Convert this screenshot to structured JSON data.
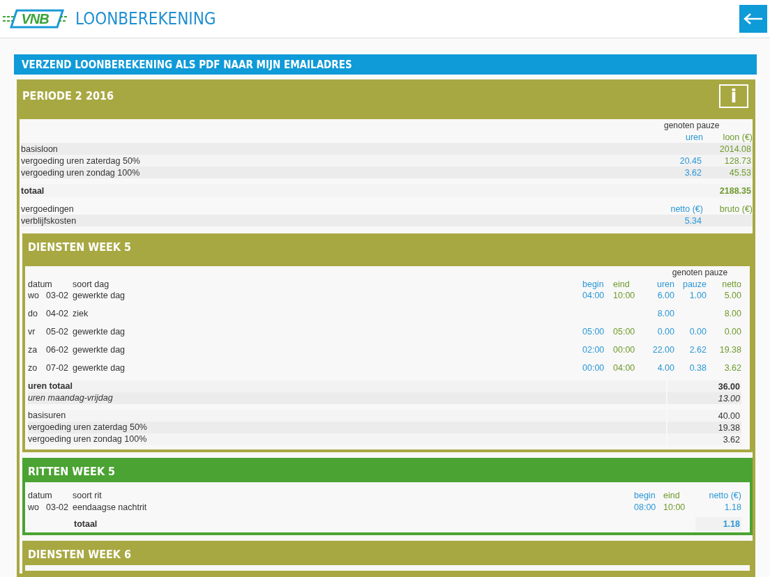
{
  "header": {
    "logo": "VNB",
    "title": "LOONBEREKENING"
  },
  "email_bar": "VERZEND LOONBEREKENING ALS PDF NAAR MIJN EMAILADRES",
  "period": {
    "title": "PERIODE 2 2016",
    "info_label": "i",
    "group_header": "genoten pauze",
    "columns": [
      "uren",
      "loon (€)"
    ],
    "rows": [
      {
        "label": "basisloon",
        "loon": "2014.08"
      },
      {
        "label": "vergoeding uren zaterdag 50%",
        "uren": "20.45",
        "loon": "128.73"
      },
      {
        "label": "vergoeding uren zondag 100%",
        "uren": "3.62",
        "loon": "45.53"
      }
    ],
    "total": {
      "label": "totaal",
      "loon": "2188.35"
    },
    "allowances": {
      "label": "vergoedingen",
      "columns": [
        "netto (€)",
        "bruto (€)"
      ],
      "rows": [
        {
          "label": "verblijfskosten",
          "netto": "5.34"
        }
      ]
    },
    "sections": [
      {
        "kind": "diensten",
        "title": "DIENSTEN WEEK 5",
        "group_header": "genoten pauze",
        "columns": [
          "datum",
          "soort dag",
          "begin",
          "eind",
          "uren",
          "pauze",
          "netto"
        ],
        "rows": [
          {
            "day": "wo",
            "date": "03-02",
            "type": "gewerkte dag",
            "begin": "04:00",
            "end": "10:00",
            "hours": "6.00",
            "pause": "1.00",
            "net": "5.00"
          },
          {
            "day": "do",
            "date": "04-02",
            "type": "ziek",
            "hours": "8.00",
            "net": "8.00"
          },
          {
            "day": "vr",
            "date": "05-02",
            "type": "gewerkte dag",
            "begin": "05:00",
            "end": "05:00",
            "hours": "0.00",
            "pause": "0.00",
            "net": "0.00"
          },
          {
            "day": "za",
            "date": "06-02",
            "type": "gewerkte dag",
            "begin": "02:00",
            "end": "00:00",
            "hours": "22.00",
            "pause": "2.62",
            "net": "19.38"
          },
          {
            "day": "zo",
            "date": "07-02",
            "type": "gewerkte dag",
            "begin": "00:00",
            "end": "04:00",
            "hours": "4.00",
            "pause": "0.38",
            "net": "3.62"
          }
        ],
        "totals": [
          {
            "kind": "bold",
            "label": "uren totaal",
            "value": "36.00"
          },
          {
            "kind": "italic",
            "label": "uren maandag-vrijdag",
            "value": "13.00"
          }
        ],
        "summary": [
          {
            "label": "basisuren",
            "value": "40.00"
          },
          {
            "label": "vergoeding uren zaterdag 50%",
            "value": "19.38"
          },
          {
            "label": "vergoeding uren zondag 100%",
            "value": "3.62"
          }
        ]
      },
      {
        "kind": "ritten",
        "title": "RITTEN WEEK 5",
        "columns": [
          "datum",
          "soort rit",
          "begin",
          "eind",
          "netto (€)"
        ],
        "rows": [
          {
            "day": "wo",
            "date": "03-02",
            "type": "eendaagse nachtrit",
            "begin": "08:00",
            "end": "10:00",
            "net": "1.18"
          }
        ],
        "total": {
          "label": "totaal",
          "value": "1.18"
        }
      },
      {
        "kind": "diensten",
        "title": "DIENSTEN WEEK 6"
      }
    ]
  }
}
